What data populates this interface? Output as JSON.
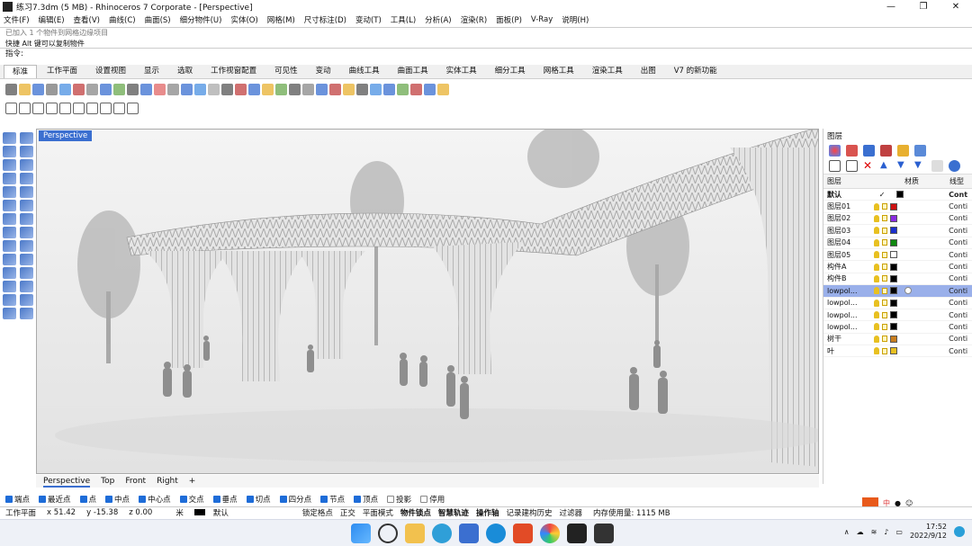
{
  "window": {
    "title": "练习7.3dm (5 MB) - Rhinoceros 7 Corporate - [Perspective]",
    "controls": [
      "—",
      "❐",
      "✕"
    ]
  },
  "menu": [
    "文件(F)",
    "编辑(E)",
    "查看(V)",
    "曲线(C)",
    "曲面(S)",
    "细分物件(U)",
    "实体(O)",
    "网格(M)",
    "尺寸标注(D)",
    "变动(T)",
    "工具(L)",
    "分析(A)",
    "渲染(R)",
    "面板(P)",
    "V-Ray",
    "说明(H)"
  ],
  "command": {
    "history": [
      "已加入 1 个物件到网格边缘项目",
      "快捷 Alt 键可以复制物件"
    ],
    "prompt": "指令:"
  },
  "tabs": [
    "标准",
    "工作平面",
    "设置视图",
    "显示",
    "选取",
    "工作视窗配置",
    "可见性",
    "变动",
    "曲线工具",
    "曲面工具",
    "实体工具",
    "细分工具",
    "网格工具",
    "渲染工具",
    "出图",
    "V7 的新功能"
  ],
  "active_tab": "标准",
  "viewport": {
    "label": "Perspective",
    "tabs": [
      "Perspective",
      "Top",
      "Front",
      "Right",
      "+"
    ],
    "active": "Perspective"
  },
  "layers_panel": {
    "title": "图层",
    "headers": [
      "图层",
      "",
      "材质",
      "线型"
    ],
    "rows": [
      {
        "name": "默认",
        "check": "✓",
        "color": "#000000",
        "ltype": "Cont",
        "current": true
      },
      {
        "name": "图层01",
        "color": "#cc1111",
        "ltype": "Conti"
      },
      {
        "name": "图层02",
        "color": "#8a2be2",
        "ltype": "Conti"
      },
      {
        "name": "图层03",
        "color": "#1a2fcc",
        "ltype": "Conti"
      },
      {
        "name": "图层04",
        "color": "#118811",
        "ltype": "Conti"
      },
      {
        "name": "图层05",
        "color": "#ffffff",
        "ltype": "Conti"
      },
      {
        "name": "构件A",
        "color": "#000000",
        "ltype": "Conti"
      },
      {
        "name": "构件B",
        "color": "#000000",
        "ltype": "Conti"
      },
      {
        "name": "lowpol...",
        "color": "#000000",
        "ltype": "Conti",
        "selected": true
      },
      {
        "name": "lowpol...",
        "color": "#000000",
        "ltype": "Conti"
      },
      {
        "name": "lowpol...",
        "color": "#000000",
        "ltype": "Conti"
      },
      {
        "name": "lowpol...",
        "color": "#000000",
        "ltype": "Conti"
      },
      {
        "name": "树干",
        "color": "#c87d1e",
        "ltype": "Conti"
      },
      {
        "name": "叶",
        "color": "#e8c020",
        "ltype": "Conti"
      }
    ]
  },
  "osnaps": [
    {
      "label": "端点",
      "on": true
    },
    {
      "label": "最近点",
      "on": true
    },
    {
      "label": "点",
      "on": true
    },
    {
      "label": "中点",
      "on": true
    },
    {
      "label": "中心点",
      "on": true
    },
    {
      "label": "交点",
      "on": true
    },
    {
      "label": "垂点",
      "on": true
    },
    {
      "label": "切点",
      "on": true
    },
    {
      "label": "四分点",
      "on": true
    },
    {
      "label": "节点",
      "on": true
    },
    {
      "label": "顶点",
      "on": true
    },
    {
      "label": "投影",
      "on": false
    },
    {
      "label": "停用",
      "on": false
    }
  ],
  "status": {
    "cplane": "工作平面",
    "x": "x 51.42",
    "y": "y -15.38",
    "z": "z 0.00",
    "unit": "米",
    "layer": "默认",
    "toggles": [
      "锁定格点",
      "正交",
      "平面模式",
      "物件锁点",
      "智慧轨迹",
      "操作轴",
      "记录建构历史",
      "过滤器"
    ],
    "bold_toggles": [
      "物件锁点",
      "智慧轨迹",
      "操作轴"
    ],
    "memory": "内存使用量: 1115 MB"
  },
  "taskbar": {
    "time": "17:52",
    "date": "2022/9/12",
    "ime": "中"
  }
}
